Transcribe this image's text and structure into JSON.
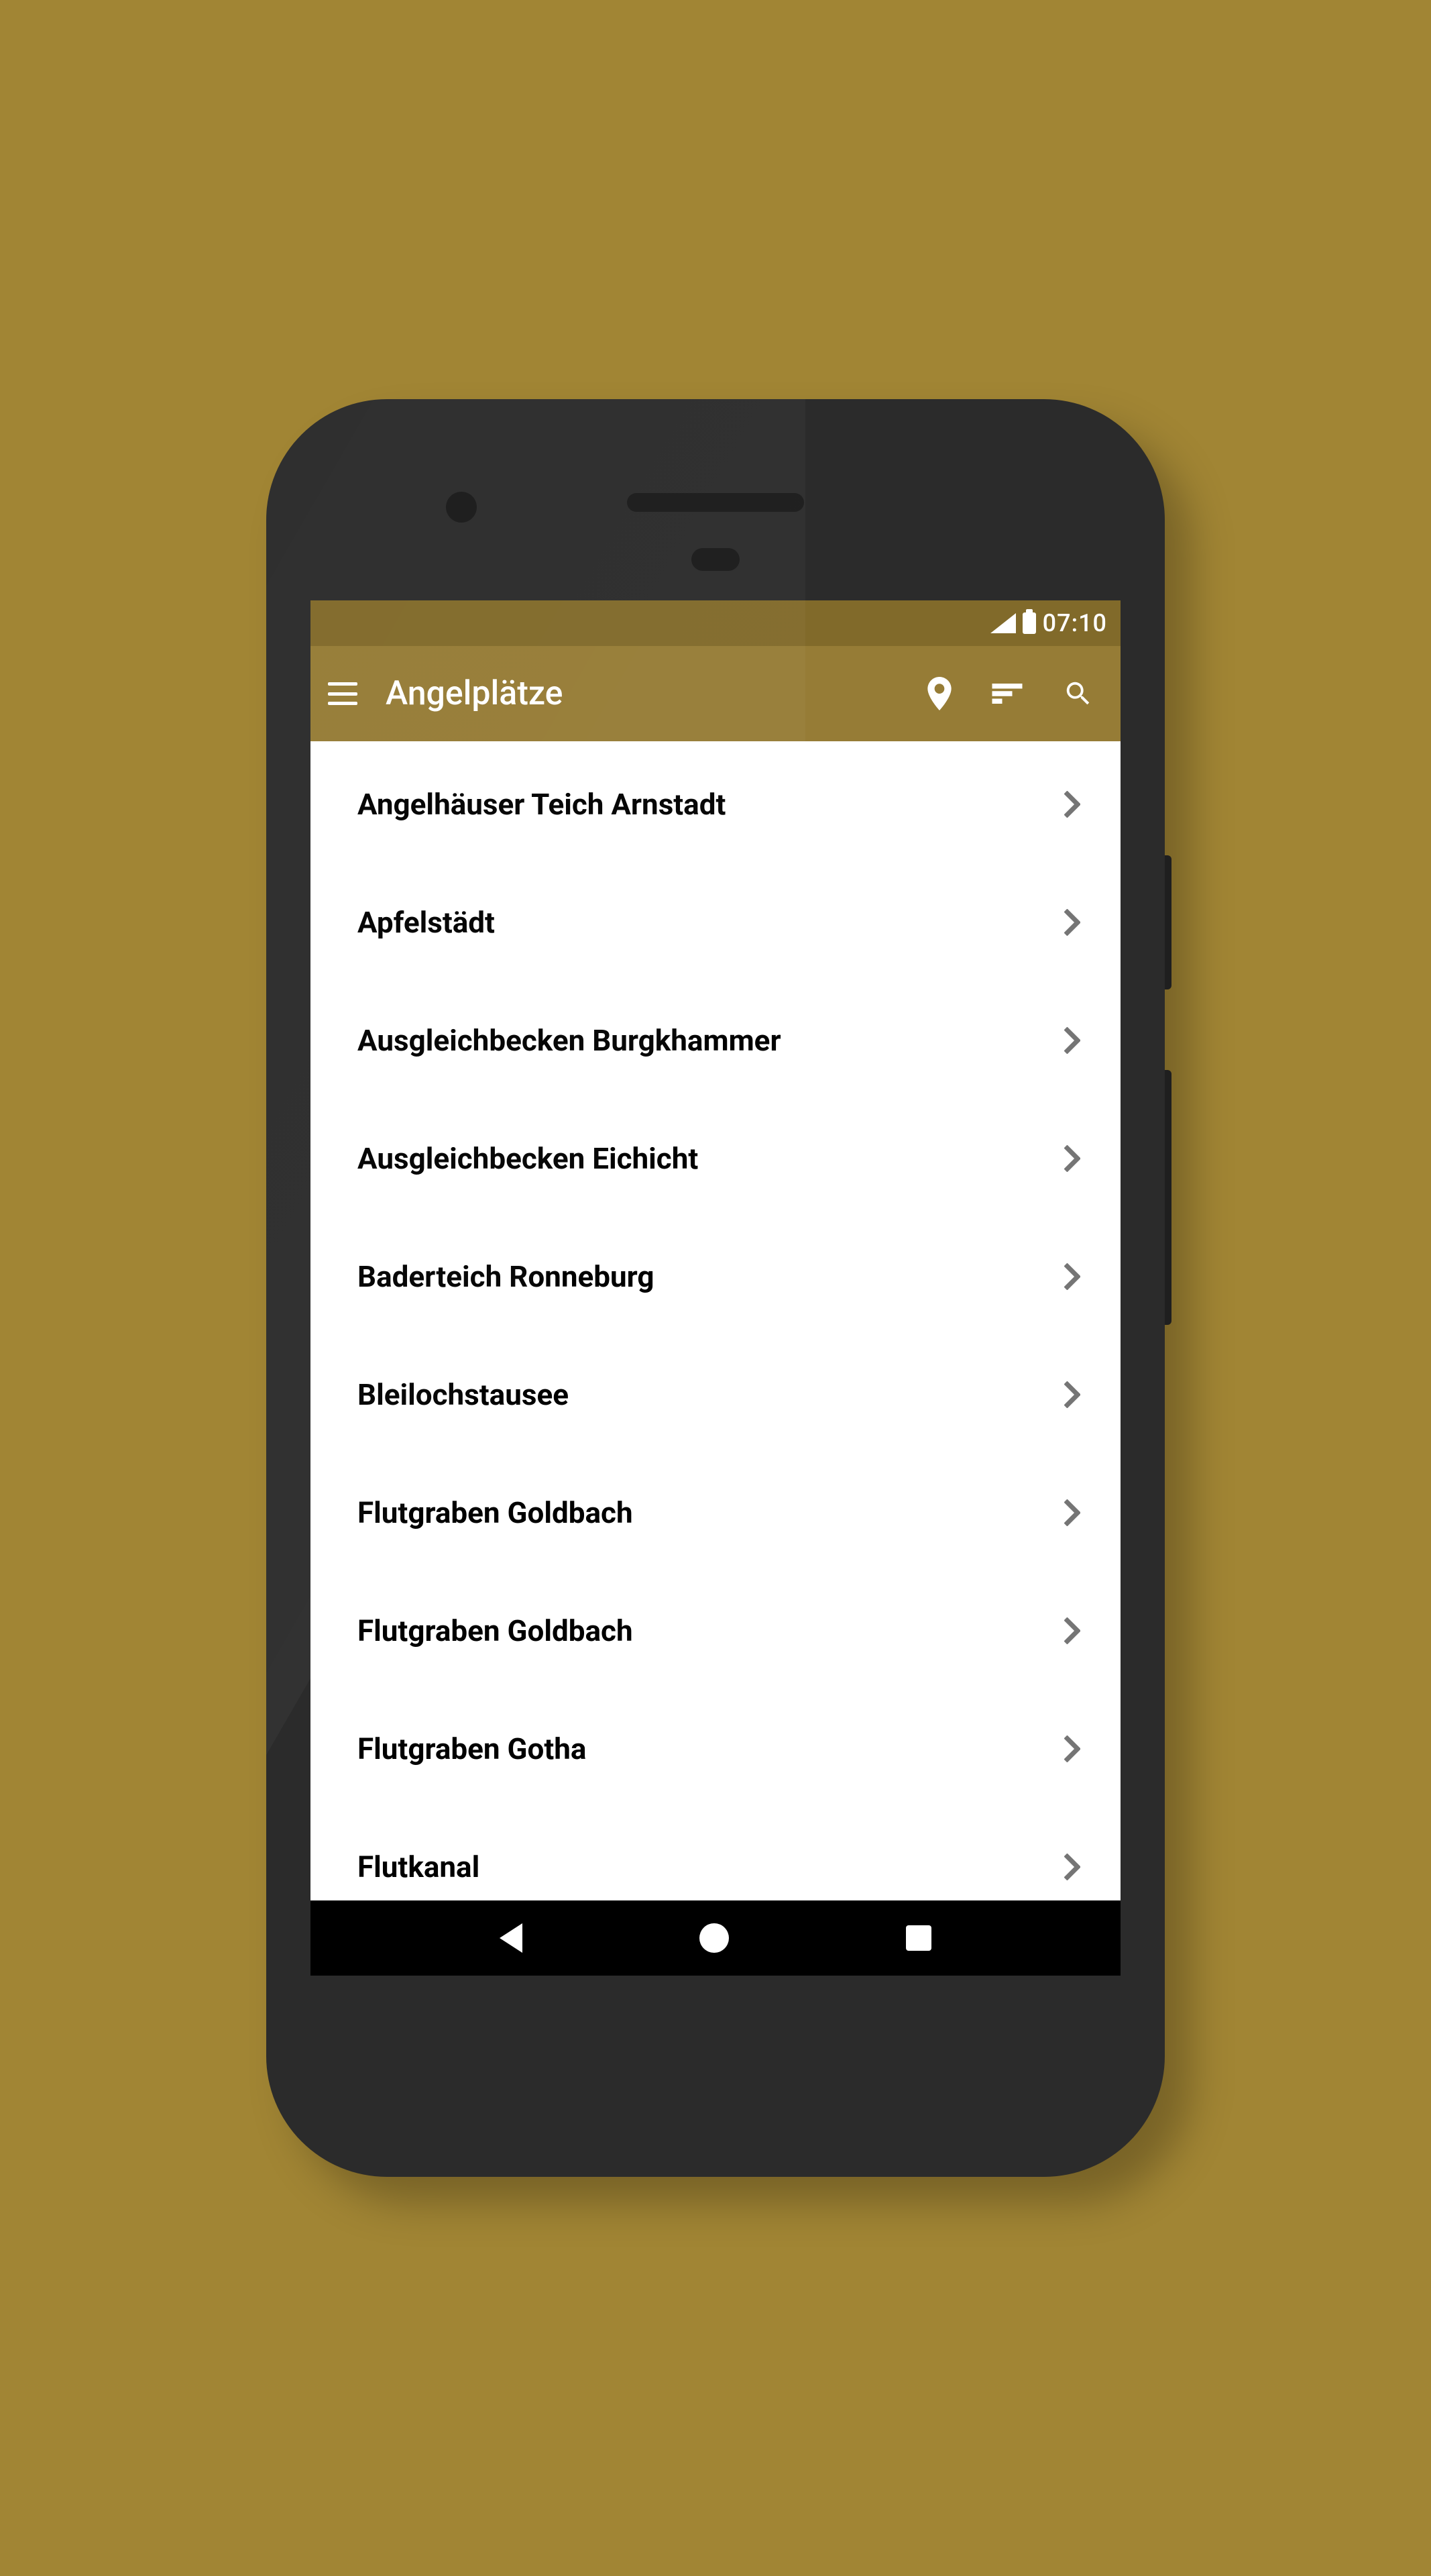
{
  "status_bar": {
    "time": "07:10"
  },
  "app_bar": {
    "title": "Angelplätze"
  },
  "list": {
    "items": [
      {
        "label": "Angelhäuser Teich Arnstadt"
      },
      {
        "label": "Apfelstädt"
      },
      {
        "label": "Ausgleichbecken Burgkhammer"
      },
      {
        "label": "Ausgleichbecken Eichicht"
      },
      {
        "label": "Baderteich Ronneburg"
      },
      {
        "label": "Bleilochstausee"
      },
      {
        "label": "Flutgraben Goldbach"
      },
      {
        "label": "Flutgraben Goldbach"
      },
      {
        "label": "Flutgraben Gotha"
      },
      {
        "label": "Flutkanal"
      }
    ]
  }
}
